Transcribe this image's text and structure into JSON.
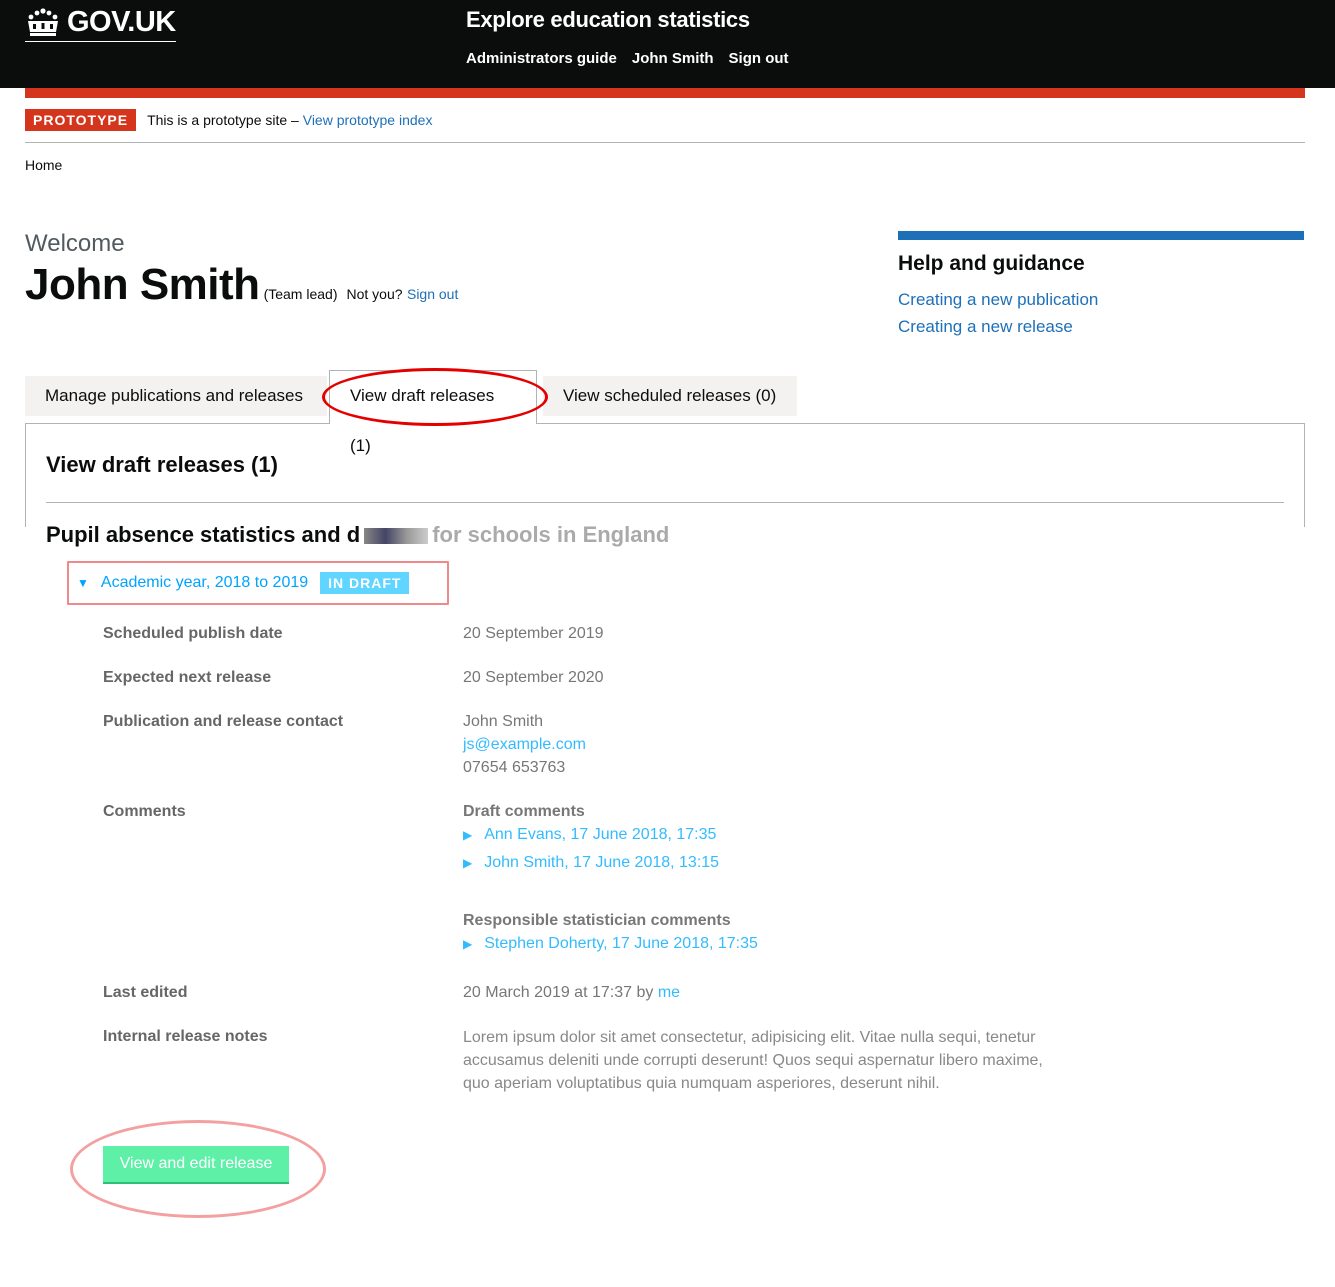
{
  "header": {
    "logo_text": "GOV.UK",
    "service_name": "Explore education statistics",
    "nav": [
      "Administrators guide",
      "John Smith",
      "Sign out"
    ]
  },
  "phase_banner": {
    "tag": "PROTOTYPE",
    "text": "This is a prototype site –",
    "link": "View prototype index"
  },
  "breadcrumb": {
    "home": "Home"
  },
  "user": {
    "welcome": "Welcome",
    "name": "John Smith",
    "role": "(Team lead)",
    "not_you": "Not you?",
    "sign_out": "Sign out"
  },
  "help": {
    "title": "Help and guidance",
    "links": [
      "Creating a new publication",
      "Creating a new release"
    ]
  },
  "tabs": [
    {
      "label": "Manage publications and releases"
    },
    {
      "label": "View draft releases (1)"
    },
    {
      "label": "View scheduled releases (0)"
    }
  ],
  "panel": {
    "title": "View draft releases (1)",
    "publication_title_a": "Pupil absence statistics and d",
    "publication_title_b": "for schools in England",
    "release_link": "Academic year, 2018 to 2019",
    "release_badge": "IN DRAFT",
    "details": {
      "scheduled_label": "Scheduled publish date",
      "scheduled_value": "20 September 2019",
      "next_label": "Expected next release",
      "next_value": "20 September 2020",
      "contact_label": "Publication and release contact",
      "contact_name": "John Smith",
      "contact_email": "js@example.com",
      "contact_phone": "07654 653763",
      "comments_label": "Comments",
      "draft_comments_heading": "Draft comments",
      "draft_comments": [
        "Ann Evans, 17 June 2018, 17:35",
        "John Smith, 17 June 2018, 13:15"
      ],
      "statistician_heading": "Responsible statistician comments",
      "statistician_comments": [
        "Stephen Doherty, 17 June 2018, 17:35"
      ],
      "last_edited_label": "Last edited",
      "last_edited_value": "20 March 2019 at 17:37 by",
      "last_edited_by": "me",
      "notes_label": "Internal release notes",
      "notes_value": "Lorem ipsum dolor sit amet consectetur, adipisicing elit. Vitae nulla sequi, tenetur accusamus deleniti unde corrupti deserunt! Quos sequi aspernatur libero maxime, quo aperiam voluptatibus quia numquam asperiores, deserunt nihil."
    },
    "button": "View and edit release"
  }
}
